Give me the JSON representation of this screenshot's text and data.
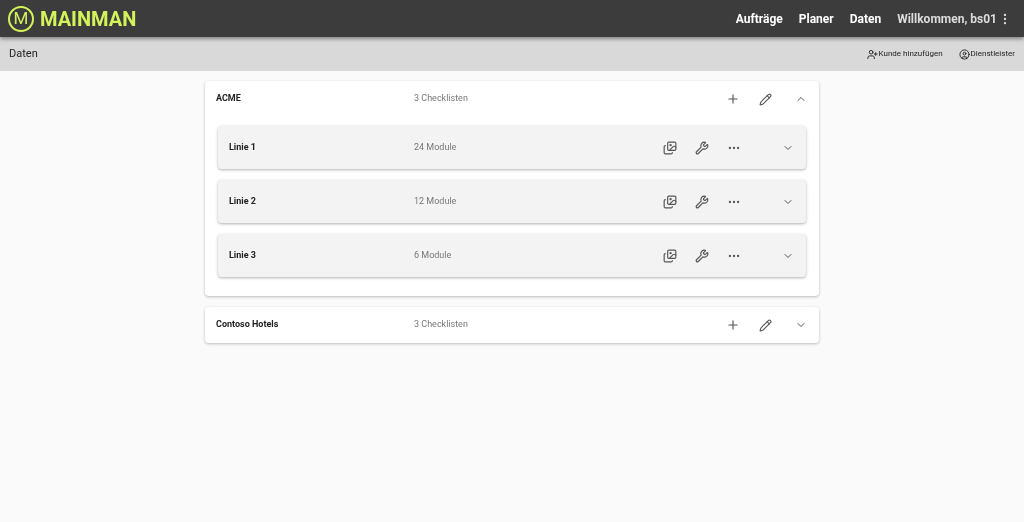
{
  "app": {
    "logo_letter": "M",
    "name": "MAINMAN"
  },
  "nav": [
    {
      "label": "Aufträge"
    },
    {
      "label": "Planer"
    },
    {
      "label": "Daten"
    }
  ],
  "user": {
    "greeting": "Willkommen, bs01"
  },
  "toolbar": {
    "title": "Daten",
    "actions": [
      {
        "kind": "add-customer",
        "label": "Kunde hinzufügen"
      },
      {
        "kind": "providers",
        "label": "Dienstleister"
      }
    ]
  },
  "customers": [
    {
      "name": "ACME",
      "count": "3 Checklisten",
      "expanded": true,
      "children": [
        {
          "name": "Linie 1",
          "count": "24 Module",
          "expanded": false
        },
        {
          "name": "Linie 2",
          "count": "12 Module",
          "expanded": false
        },
        {
          "name": "Linie 3",
          "count": "6 Module",
          "expanded": false
        }
      ]
    },
    {
      "name": "Contoso Hotels",
      "count": "3 Checklisten",
      "expanded": false
    }
  ]
}
